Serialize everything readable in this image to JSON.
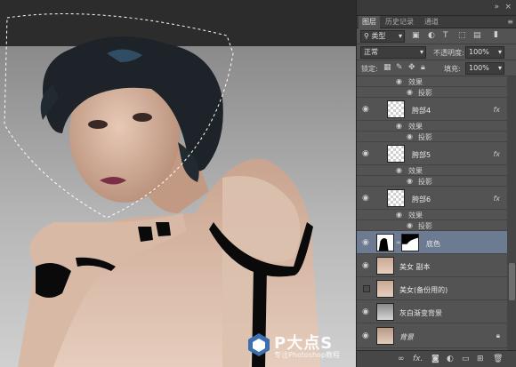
{
  "panel": {
    "tabs": [
      "图层",
      "历史记录",
      "通道"
    ],
    "filter_kind": "类型",
    "blend_mode": "正常",
    "opacity_label": "不透明度:",
    "opacity_value": "100%",
    "lock_label": "锁定:",
    "fill_label": "填充:",
    "fill_value": "100%"
  },
  "layers": [
    {
      "kind": "effect",
      "label": "效果"
    },
    {
      "kind": "effect-item",
      "label": "投影"
    },
    {
      "kind": "layer",
      "name": "胯部4",
      "fx": "fx"
    },
    {
      "kind": "effect",
      "label": "效果"
    },
    {
      "kind": "effect-item",
      "label": "投影"
    },
    {
      "kind": "layer",
      "name": "胯部5",
      "fx": "fx"
    },
    {
      "kind": "effect",
      "label": "效果"
    },
    {
      "kind": "effect-item",
      "label": "投影"
    },
    {
      "kind": "layer",
      "name": "胯部6",
      "fx": "fx"
    },
    {
      "kind": "effect",
      "label": "效果"
    },
    {
      "kind": "effect-item",
      "label": "投影"
    },
    {
      "kind": "layer",
      "name": "底色",
      "selected": true
    },
    {
      "kind": "layer",
      "name": "美女 副本"
    },
    {
      "kind": "layer",
      "name": "美女(备份用的)",
      "hidden": true
    },
    {
      "kind": "layer",
      "name": "灰白渐变背景"
    },
    {
      "kind": "layer",
      "name": "背景",
      "italic": true,
      "locked": true
    }
  ],
  "watermark": {
    "title": "P大点S",
    "subtitle": "专注Photoshop教程"
  },
  "icons": {
    "eye": "eye-icon",
    "lock": "lock-icon",
    "fx": "fx-icon",
    "link": "link-icon"
  },
  "colors": {
    "panel_bg": "#535353",
    "selected_layer": "#6c7b91",
    "canvas_bg": "#2c2c2c"
  }
}
